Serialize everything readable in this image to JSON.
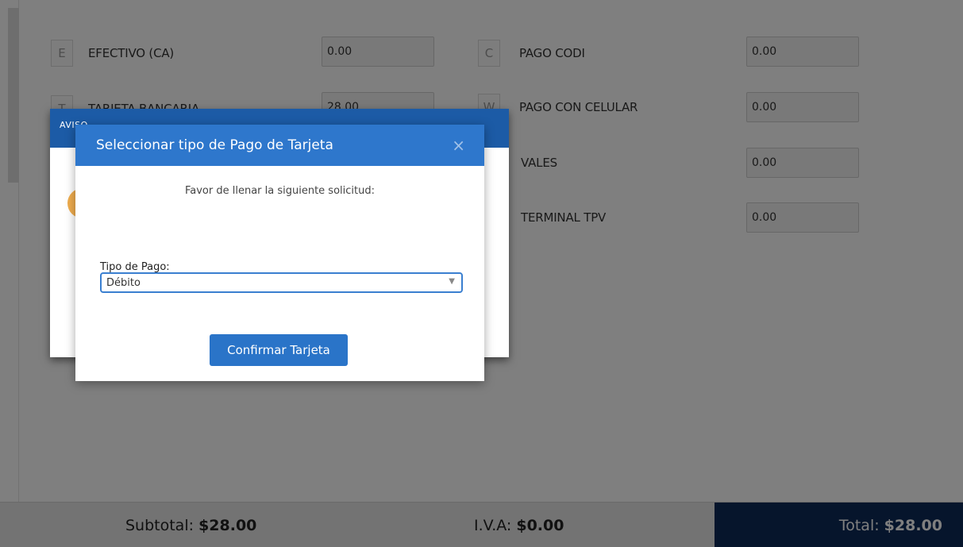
{
  "payments_left": [
    {
      "key": "E",
      "label": "EFECTIVO (CA)",
      "value": "0.00"
    },
    {
      "key": "T",
      "label": "TARJETA BANCARIA",
      "value": "28.00"
    }
  ],
  "payments_right": [
    {
      "key": "C",
      "label": "PAGO CODI",
      "value": "0.00"
    },
    {
      "key": "W",
      "label": "PAGO CON CELULAR",
      "value": "0.00"
    },
    {
      "key": "",
      "label": "VALES",
      "value": "0.00"
    },
    {
      "key": "",
      "label": "TERMINAL TPV",
      "value": "0.00"
    }
  ],
  "footer": {
    "subtotal_label": "Subtotal:",
    "subtotal_value": "$28.00",
    "iva_label": "I.V.A:",
    "iva_value": "$0.00",
    "total_label": "Total:",
    "total_value": "$28.00"
  },
  "aviso": {
    "title": "AVISO"
  },
  "modal": {
    "title": "Seleccionar tipo de Pago de Tarjeta",
    "close": "×",
    "intro": "Favor de llenar la siguiente solicitud:",
    "field_label": "Tipo de Pago:",
    "selected_option": "Débito",
    "confirm_label": "Confirmar Tarjeta"
  },
  "colors": {
    "modal_header": "#2e77cc",
    "total_bg": "#0d2a59",
    "button": "#2a74c8"
  }
}
